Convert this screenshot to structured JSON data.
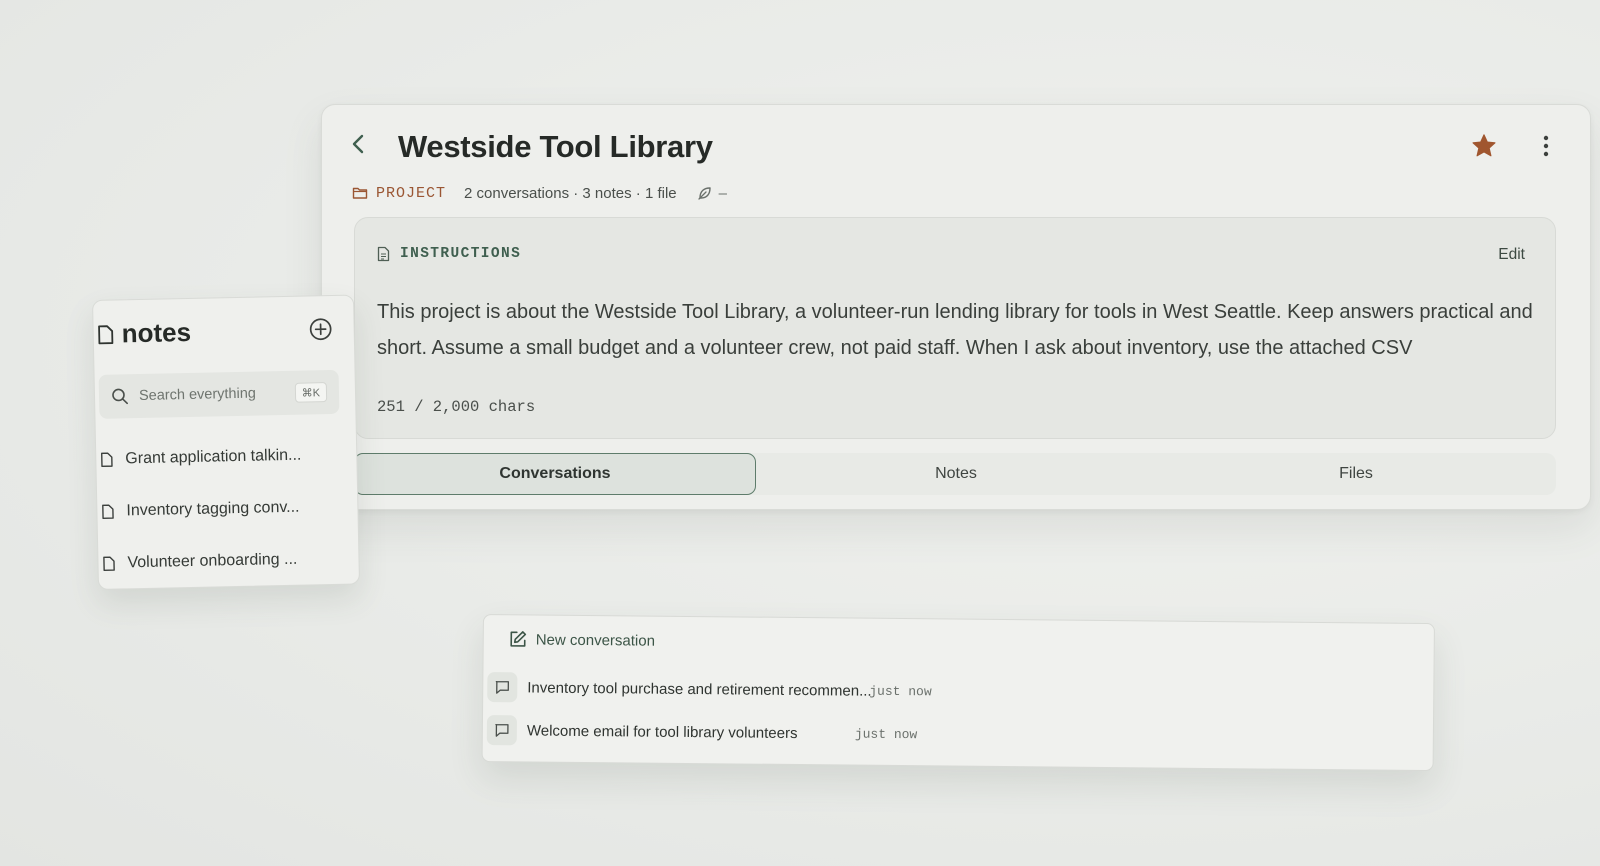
{
  "project": {
    "title": "Westside Tool Library",
    "tag": "PROJECT",
    "counts": "2 conversations · 3 notes · 1 file",
    "extra": "–"
  },
  "instructions": {
    "header": "INSTRUCTIONS",
    "edit_label": "Edit",
    "text": "This project is about the Westside Tool Library, a volunteer-run lending library for tools in West Seattle. Keep answers practical and short. Assume a small budget and a volunteer crew, not paid staff. When I ask about inventory, use the attached CSV",
    "char_count": "251 / 2,000 chars"
  },
  "tabs": [
    {
      "label": "Conversations",
      "active": true
    },
    {
      "label": "Notes",
      "active": false
    },
    {
      "label": "Files",
      "active": false
    }
  ],
  "notes_panel": {
    "title": "notes",
    "search_placeholder": "Search everything",
    "shortcut": "⌘K",
    "items": [
      {
        "label": "Grant application talkin..."
      },
      {
        "label": "Inventory tagging conv..."
      },
      {
        "label": "Volunteer onboarding ..."
      }
    ]
  },
  "conversations_panel": {
    "new_label": "New conversation",
    "items": [
      {
        "title": "Inventory tool purchase and retirement recommen...",
        "time": "just now"
      },
      {
        "title": "Welcome email for tool library volunteers",
        "time": "just now"
      }
    ]
  },
  "colors": {
    "accent": "#5e7c6b",
    "star": "#a0562f",
    "project_tag": "#9a5633"
  }
}
